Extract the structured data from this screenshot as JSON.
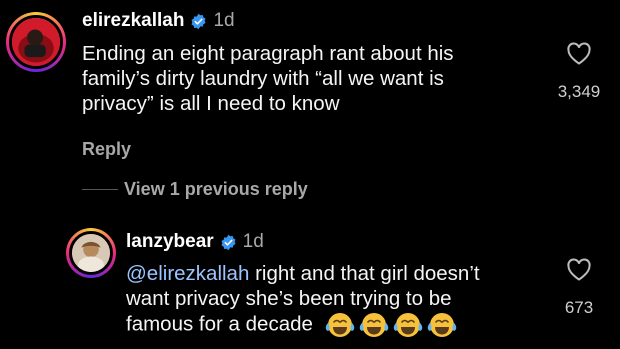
{
  "comments": [
    {
      "username": "elirezkallah",
      "verified": true,
      "time": "1d",
      "lines": [
        "Ending an eight paragraph rant about his",
        "family’s dirty laundry with “all we want is",
        "privacy” is all I need to know"
      ],
      "reply_label": "Reply",
      "like_count": "3,349"
    },
    {
      "username": "lanzybear",
      "verified": true,
      "time": "1d",
      "mention": "@elirezkallah",
      "lines": [
        " right and that girl doesn’t",
        "want privacy she’s been trying to be",
        "famous for a decade"
      ],
      "emoji": [
        "face-with-tears-of-joy",
        "face-with-tears-of-joy",
        "face-with-tears-of-joy",
        "face-with-tears-of-joy"
      ],
      "like_count": "673"
    }
  ],
  "view_previous_label": "View 1 previous reply",
  "colors": {
    "background": "#000000",
    "text": "#f5f5f5",
    "muted": "#a8a8a8",
    "verified": "#3897f0",
    "mention": "#9cc4ff"
  }
}
